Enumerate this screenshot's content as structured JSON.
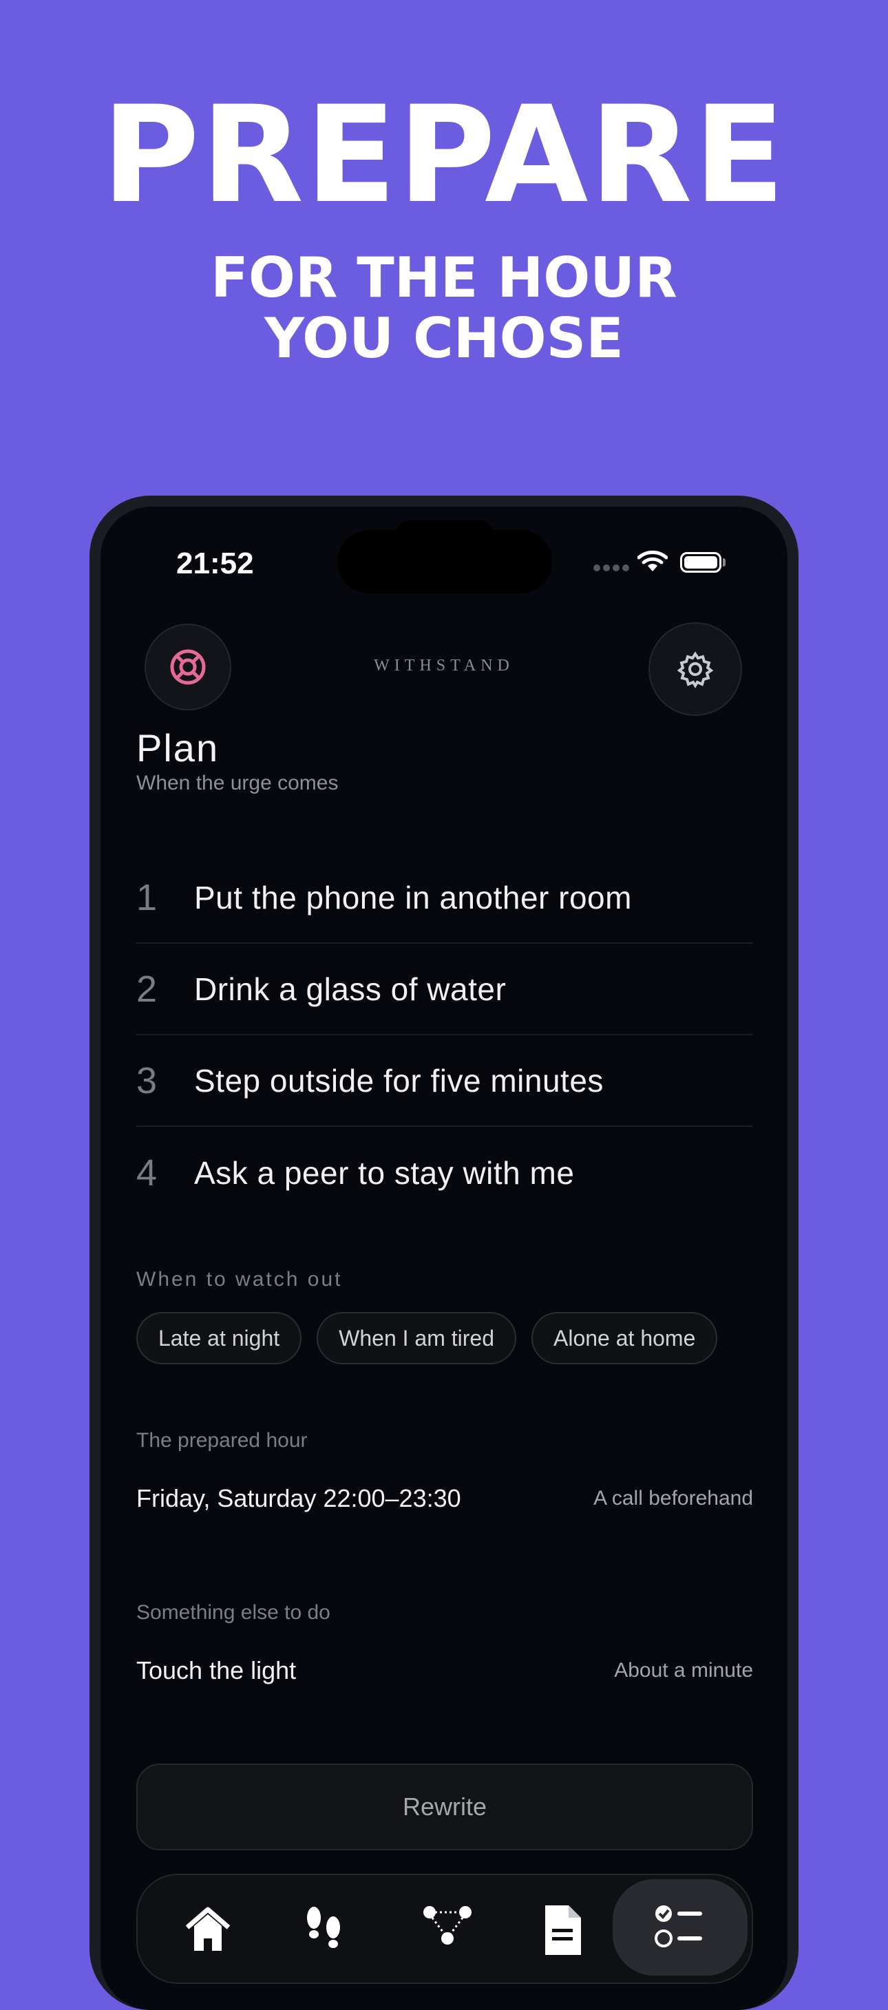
{
  "marketing": {
    "headline": "PREPARE",
    "subline_1": "FOR THE HOUR",
    "subline_2": "YOU CHOSE"
  },
  "status_bar": {
    "time": "21:52"
  },
  "header": {
    "brand": "WITHSTAND",
    "left_icon": "lifebuoy-icon",
    "right_icon": "gear-icon"
  },
  "plan": {
    "title": "Plan",
    "subtitle": "When the urge comes",
    "steps": [
      {
        "num": "1",
        "text": "Put the phone in another room"
      },
      {
        "num": "2",
        "text": "Drink a glass of water"
      },
      {
        "num": "3",
        "text": "Step outside for five minutes"
      },
      {
        "num": "4",
        "text": "Ask a peer to stay with me"
      }
    ]
  },
  "watch_out": {
    "label": "When to watch out",
    "chips": [
      "Late at night",
      "When I am tired",
      "Alone at home"
    ]
  },
  "prepared_hour": {
    "label": "The prepared hour",
    "value": "Friday, Saturday 22:00–23:30",
    "note": "A call beforehand"
  },
  "something_else": {
    "label": "Something else to do",
    "value": "Touch the light",
    "note": "About a minute"
  },
  "actions": {
    "rewrite_label": "Rewrite"
  },
  "tabbar": {
    "tabs": [
      "home-icon",
      "footsteps-icon",
      "network-icon",
      "document-icon",
      "checklist-icon"
    ],
    "active": "checklist-icon"
  },
  "colors": {
    "background": "#6c5ce0",
    "screen": "#06080d",
    "accent_pink": "#e66a93"
  }
}
